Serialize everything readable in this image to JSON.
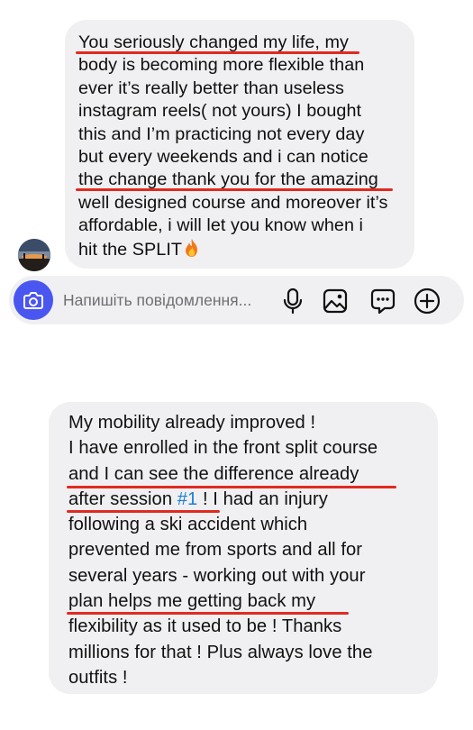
{
  "messages": [
    {
      "lines": [
        "You seriously changed my life, my",
        "body is becoming more flexible than",
        "ever it’s really better than useless",
        "instagram reels( not yours) I bought",
        "this and I’m practicing not every day",
        "but every weekends and i can notice",
        "the change thank you for the amazing",
        "well designed course and moreover it’s",
        "affordable, i will let you know when i",
        "hit the SPLIT"
      ],
      "emoji": "fire-icon"
    },
    {
      "lines": [
        "My mobility already improved !",
        "I have enrolled in the front split course",
        "and I can see the difference already",
        "after session ",
        "#1",
        " ! I had an injury",
        "following a ski accident which",
        "prevented me from sports and all for",
        "several years - working out with your",
        "plan helps me getting back my",
        "flexibility as it used to be ! Thanks",
        "millions for that ! Plus always love the",
        "outfits !"
      ]
    }
  ],
  "composer": {
    "placeholder": "Напишіть повідомлення...",
    "icons": [
      "camera-icon",
      "microphone-icon",
      "gallery-icon",
      "sticker-icon",
      "add-icon"
    ],
    "accent_color": "#4a56f0"
  },
  "colors": {
    "bubble": "#f0f0f3",
    "underline": "#e12a1f",
    "link": "#1a7fd6"
  }
}
